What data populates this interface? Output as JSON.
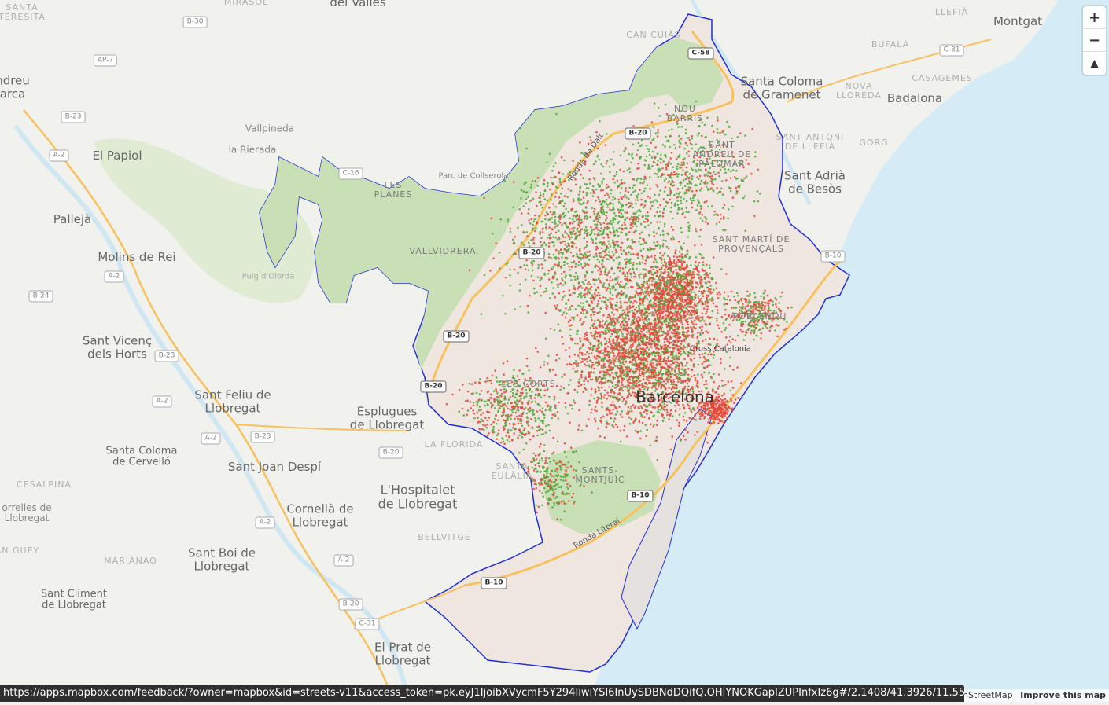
{
  "map": {
    "colors": {
      "land": "#f1f1ee",
      "water": "#d5ecf7",
      "park": "#cfe4c0",
      "city_fill": "#efe6e0",
      "boundary": "#1f2fd8",
      "dot_red": "#e8443a",
      "dot_green": "#4caa38",
      "highway": "#f7c15e"
    },
    "city_labels": [
      {
        "text": "Santa Coloma\nde Gramenet"
      },
      {
        "text": "Badalona"
      },
      {
        "text": "Montgat"
      },
      {
        "text": "Sant Adrià\nde Besòs"
      },
      {
        "text": "El Papiol"
      },
      {
        "text": "Pallejà"
      },
      {
        "text": "Molins de Rei"
      },
      {
        "text": "Sant Vicenç\ndels Horts"
      },
      {
        "text": "Sant Feliu de\nLlobregat"
      },
      {
        "text": "Esplugues\nde Llobregat"
      },
      {
        "text": "Santa Coloma\nde Cervelló"
      },
      {
        "text": "Sant Joan Despí"
      },
      {
        "text": "Cornellà de\nLlobregat"
      },
      {
        "text": "L'Hospitalet\nde Llobregat"
      },
      {
        "text": "Sant Boi de\nLlobregat"
      },
      {
        "text": "Sant Climent\nde Llobregat"
      },
      {
        "text": "El Prat de\nLlobregat"
      },
      {
        "text": "ndreu\narca"
      },
      {
        "text": "del Vallès"
      },
      {
        "text": "Vallpineda"
      },
      {
        "text": "la Rierada"
      }
    ],
    "district_labels": [
      {
        "text": "NOU\nBARRIS"
      },
      {
        "text": "SANT\nANDREU DE\nPALOMAR"
      },
      {
        "text": "SANT MARTÍ DE\nPROVENÇALS"
      },
      {
        "text": "LES\nPLANES"
      },
      {
        "text": "VALLVIDRERA"
      },
      {
        "text": "LES CORTS"
      },
      {
        "text": "SANTS-\nMONTJUÏC"
      },
      {
        "text": "POBLENOU"
      },
      {
        "text": "SANTA\nEULÀLIA"
      },
      {
        "text": "LA FLORIDA"
      },
      {
        "text": "BELLVITGE"
      },
      {
        "text": "CAN CUIÀS"
      },
      {
        "text": "NOVA\nLLOREDA"
      },
      {
        "text": "CASAGEMES"
      },
      {
        "text": "BUFALÀ"
      },
      {
        "text": "GORG"
      },
      {
        "text": "SANT ANTONI\nDE LLEFIÀ"
      },
      {
        "text": "CESALPINA"
      },
      {
        "text": "MARIANAO"
      },
      {
        "text": "SANTA\nTERESITA"
      },
      {
        "text": "MIRASOL"
      },
      {
        "text": "LLEFIÀ"
      }
    ],
    "place_labels": [
      {
        "text": "Parc de Collserola"
      },
      {
        "text": "Puig d'Olorda"
      },
      {
        "text": "Ronda de Dalt"
      },
      {
        "text": "Ronda Litoral"
      },
      {
        "text": "Barcelona"
      },
      {
        "text": "Cross Catalonia"
      },
      {
        "text": "orrelles de\nLlobregat"
      },
      {
        "text": "AN GUEY"
      }
    ],
    "road_shields": [
      {
        "text": "B-30",
        "kind": "grey"
      },
      {
        "text": "AP-7",
        "kind": "grey"
      },
      {
        "text": "B-23",
        "kind": "grey"
      },
      {
        "text": "A-2",
        "kind": "grey"
      },
      {
        "text": "A-2",
        "kind": "grey"
      },
      {
        "text": "B-24",
        "kind": "grey"
      },
      {
        "text": "B-23",
        "kind": "grey"
      },
      {
        "text": "A-2",
        "kind": "grey"
      },
      {
        "text": "A-2",
        "kind": "grey"
      },
      {
        "text": "B-23",
        "kind": "grey"
      },
      {
        "text": "A-2",
        "kind": "grey"
      },
      {
        "text": "A-2",
        "kind": "grey"
      },
      {
        "text": "B-20",
        "kind": "grey"
      },
      {
        "text": "B-20",
        "kind": "grey"
      },
      {
        "text": "C-31",
        "kind": "grey"
      },
      {
        "text": "C-58",
        "kind": "main"
      },
      {
        "text": "B-20",
        "kind": "main"
      },
      {
        "text": "B-20",
        "kind": "main"
      },
      {
        "text": "B-20",
        "kind": "main"
      },
      {
        "text": "B-20",
        "kind": "main"
      },
      {
        "text": "B-10",
        "kind": "main"
      },
      {
        "text": "B-10",
        "kind": "main"
      },
      {
        "text": "B-10",
        "kind": "grey"
      },
      {
        "text": "C-31",
        "kind": "grey"
      },
      {
        "text": "C-16",
        "kind": "grey"
      }
    ]
  },
  "controls": {
    "zoom_in": "+",
    "zoom_out": "−",
    "reset_north": "▲"
  },
  "status_bar": {
    "url": "https://apps.mapbox.com/feedback/?owner=mapbox&id=streets-v11&access_token=pk.eyJ1IjoibXVycmF5Y294IiwiYSI6InUySDBNdDQifQ.OHlYNOKGapIZUPInfxIz6g#/2.1408/41.3926/11.55"
  },
  "attribution": {
    "text": "OpenStreetMap",
    "improve": "Improve this map"
  }
}
